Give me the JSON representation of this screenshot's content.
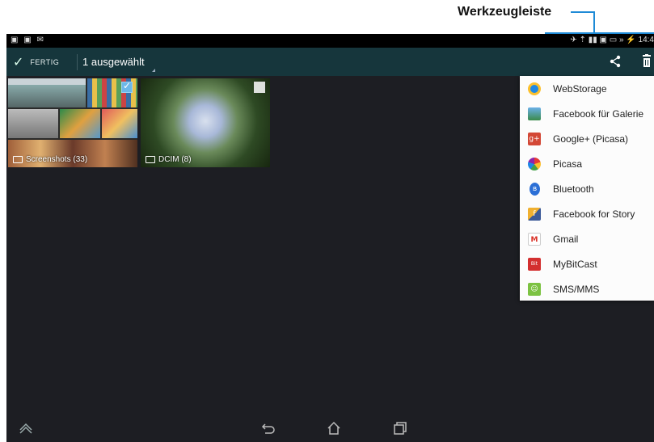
{
  "annotation": {
    "label": "Werkzeugleiste",
    "color": "#1e8ad6"
  },
  "statusbar": {
    "left_icons": "▣ ▣ ✉",
    "right_icons": "✈ ⇡ ▮▮ ▣ ▭ »",
    "battery_icon": "⚡",
    "time": "14:4"
  },
  "actionbar": {
    "done_label": "FERTIG",
    "selection_count": "1 ausgewählt",
    "bg_color": "#16363c"
  },
  "albums": [
    {
      "name": "Screenshots (33)",
      "checked": true
    },
    {
      "name": "DCIM (8)",
      "checked": false
    }
  ],
  "share_menu": [
    {
      "label": "WebStorage",
      "icon": "webstorage-icon"
    },
    {
      "label": "Facebook für Galerie",
      "icon": "facebook-gallery-icon"
    },
    {
      "label": "Google+ (Picasa)",
      "icon": "google-plus-icon"
    },
    {
      "label": "Picasa",
      "icon": "picasa-icon"
    },
    {
      "label": "Bluetooth",
      "icon": "bluetooth-icon"
    },
    {
      "label": "Facebook for Story",
      "icon": "facebook-story-icon"
    },
    {
      "label": "Gmail",
      "icon": "gmail-icon"
    },
    {
      "label": "MyBitCast",
      "icon": "mybitcast-icon"
    },
    {
      "label": "SMS/MMS",
      "icon": "sms-icon"
    }
  ]
}
